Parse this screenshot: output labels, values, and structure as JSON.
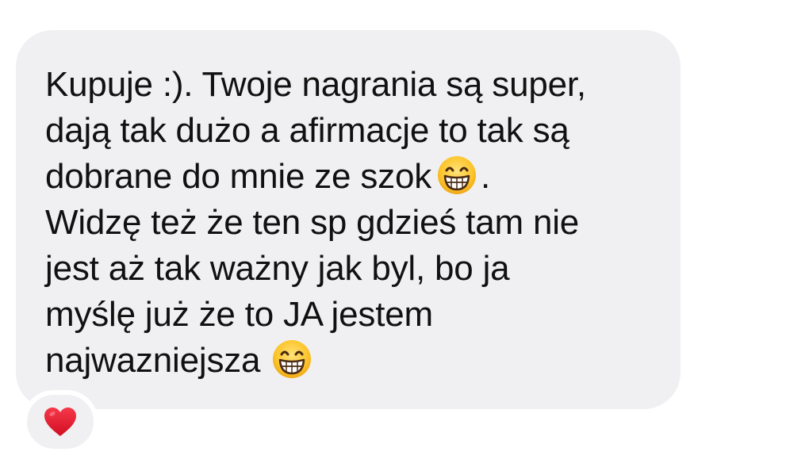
{
  "message": {
    "lines": [
      {
        "before": "Kupuje :). Twoje nagrania są super,",
        "after": ""
      },
      {
        "before": "dają tak dużo a afirmacje to tak są",
        "after": ""
      },
      {
        "before": "dobrane do mnie ze szok",
        "after": "."
      },
      {
        "before": "Widzę też że ten sp gdzieś tam nie",
        "after": ""
      },
      {
        "before": "jest aż tak ważny jak byl, bo ja",
        "after": ""
      },
      {
        "before": "myślę już że to JA jestem",
        "after": ""
      },
      {
        "before": "najwazniejsza",
        "after": ""
      }
    ],
    "emoji_name": "grinning-face-with-smiling-eyes-icon"
  },
  "reaction": {
    "icon": "red-heart-icon",
    "color": "#e3132a"
  },
  "colors": {
    "bubble": "#f0f0f2",
    "text": "#111111",
    "background": "#ffffff"
  }
}
